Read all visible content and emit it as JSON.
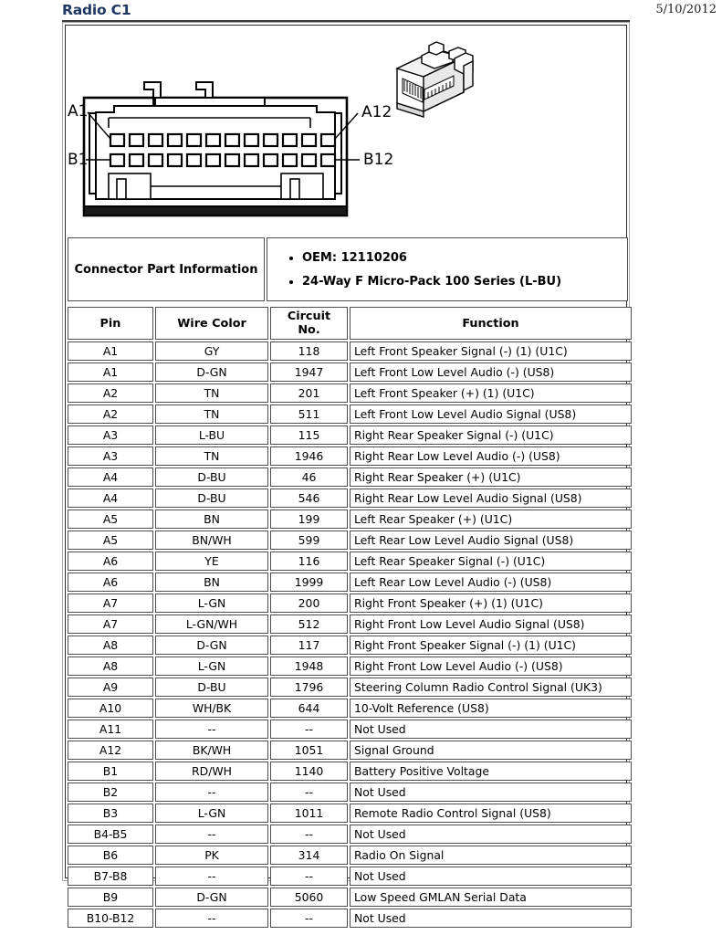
{
  "header": {
    "title": "Radio C1",
    "date": "5/10/2012"
  },
  "illustration": {
    "label_a1": "A1",
    "label_a12": "A12",
    "label_b1": "B1",
    "label_b12": "B12",
    "row_a_pins": 12,
    "row_b_pins": 12
  },
  "part_info": {
    "label": "Connector Part Information",
    "bullets": [
      "OEM: 12110206",
      "24-Way F Micro-Pack 100 Series (L-BU)"
    ]
  },
  "pinout": {
    "columns": [
      "Pin",
      "Wire Color",
      "Circuit No.",
      "Function"
    ],
    "rows": [
      [
        "A1",
        "GY",
        "118",
        "Left Front Speaker Signal (-) (1) (U1C)"
      ],
      [
        "A1",
        "D-GN",
        "1947",
        "Left Front Low Level Audio (-) (US8)"
      ],
      [
        "A2",
        "TN",
        "201",
        "Left Front Speaker (+) (1) (U1C)"
      ],
      [
        "A2",
        "TN",
        "511",
        "Left Front Low Level Audio Signal (US8)"
      ],
      [
        "A3",
        "L-BU",
        "115",
        "Right Rear Speaker Signal (-) (U1C)"
      ],
      [
        "A3",
        "TN",
        "1946",
        "Right Rear Low Level Audio (-) (US8)"
      ],
      [
        "A4",
        "D-BU",
        "46",
        "Right Rear Speaker (+) (U1C)"
      ],
      [
        "A4",
        "D-BU",
        "546",
        "Right Rear Low Level Audio Signal (US8)"
      ],
      [
        "A5",
        "BN",
        "199",
        "Left Rear Speaker (+) (U1C)"
      ],
      [
        "A5",
        "BN/WH",
        "599",
        "Left Rear Low Level Audio Signal (US8)"
      ],
      [
        "A6",
        "YE",
        "116",
        "Left Rear Speaker Signal (-) (U1C)"
      ],
      [
        "A6",
        "BN",
        "1999",
        "Left Rear Low Level Audio (-) (US8)"
      ],
      [
        "A7",
        "L-GN",
        "200",
        "Right Front Speaker (+) (1) (U1C)"
      ],
      [
        "A7",
        "L-GN/WH",
        "512",
        "Right Front Low Level Audio Signal (US8)"
      ],
      [
        "A8",
        "D-GN",
        "117",
        "Right Front Speaker Signal (-) (1) (U1C)"
      ],
      [
        "A8",
        "L-GN",
        "1948",
        "Right Front Low Level Audio (-) (US8)"
      ],
      [
        "A9",
        "D-BU",
        "1796",
        "Steering Column Radio Control Signal (UK3)"
      ],
      [
        "A10",
        "WH/BK",
        "644",
        "10-Volt Reference (US8)"
      ],
      [
        "A11",
        "--",
        "--",
        "Not Used"
      ],
      [
        "A12",
        "BK/WH",
        "1051",
        "Signal Ground"
      ],
      [
        "B1",
        "RD/WH",
        "1140",
        "Battery Positive Voltage"
      ],
      [
        "B2",
        "--",
        "--",
        "Not Used"
      ],
      [
        "B3",
        "L-GN",
        "1011",
        "Remote Radio Control Signal (US8)"
      ],
      [
        "B4-B5",
        "--",
        "--",
        "Not Used"
      ],
      [
        "B6",
        "PK",
        "314",
        "Radio On Signal"
      ],
      [
        "B7-B8",
        "--",
        "--",
        "Not Used"
      ],
      [
        "B9",
        "D-GN",
        "5060",
        "Low Speed GMLAN Serial Data"
      ],
      [
        "B10-B12",
        "--",
        "--",
        "Not Used"
      ]
    ]
  }
}
